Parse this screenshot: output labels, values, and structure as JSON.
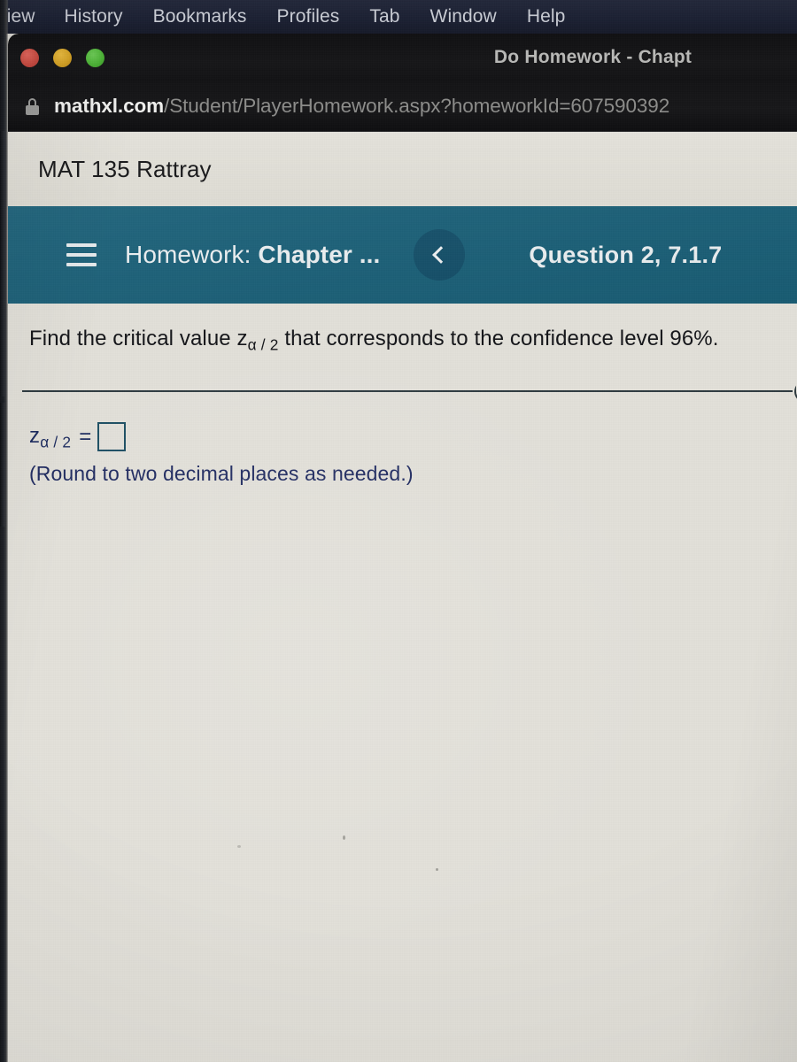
{
  "menubar": {
    "items": [
      {
        "label": "View"
      },
      {
        "label": "History"
      },
      {
        "label": "Bookmarks"
      },
      {
        "label": "Profiles"
      },
      {
        "label": "Tab"
      },
      {
        "label": "Window"
      },
      {
        "label": "Help"
      }
    ]
  },
  "window": {
    "title": "Do Homework - Chapt",
    "traffic_lights": {
      "close": "close-button-red",
      "minimize": "minimize-button-yellow",
      "zoom": "zoom-button-green"
    },
    "colors": {
      "red": "#c74a40",
      "yellow": "#d3a024",
      "green": "#4bb135"
    }
  },
  "addressbar": {
    "lock_icon": "lock-icon",
    "host": "mathxl.com",
    "path": "/Student/PlayerHomework.aspx?homeworkId=607590392"
  },
  "page": {
    "course_title": "MAT 135 Rattray",
    "header": {
      "menu_icon": "hamburger-menu-icon",
      "label_prefix": "Homework:",
      "label_title": "Chapter ...",
      "back_icon": "chevron-left-icon",
      "question_id": "Question 2, 7.1.7",
      "background_color": "#1a6078"
    },
    "problem": {
      "prompt_part1": "Find the critical value z",
      "prompt_sub1": "α / 2",
      "prompt_part2": " that corresponds to the confidence level 96%.",
      "answer_label": "z",
      "answer_label_sub": "α / 2",
      "equals": "=",
      "answer_value": "",
      "answer_placeholder": "",
      "rounding_note": "(Round to two decimal places as needed.)",
      "accent_color": "#1b2a5e"
    }
  }
}
